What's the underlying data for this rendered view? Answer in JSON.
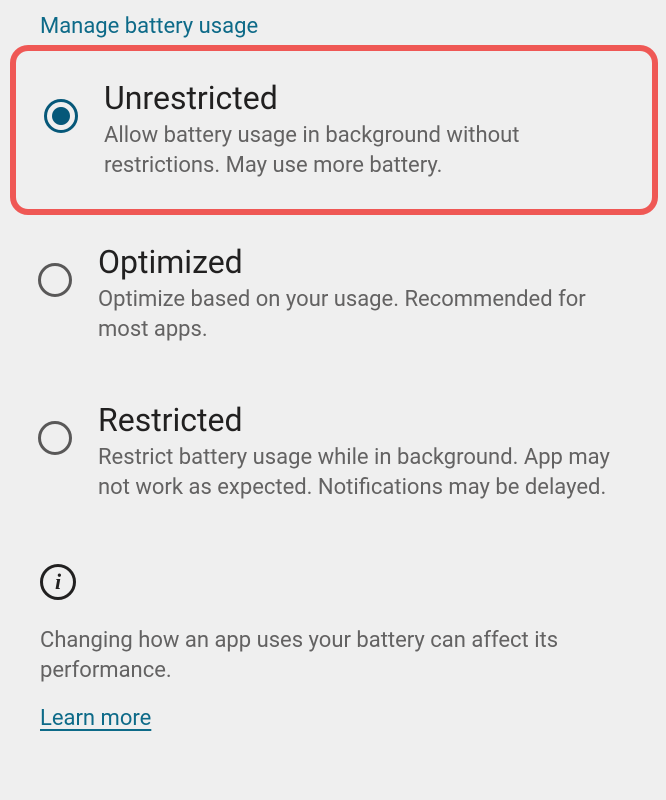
{
  "section": {
    "header": "Manage battery usage"
  },
  "options": [
    {
      "title": "Unrestricted",
      "description": "Allow battery usage in background without restrictions. May use more battery.",
      "selected": true,
      "highlighted": true
    },
    {
      "title": "Optimized",
      "description": "Optimize based on your usage. Recommended for most apps.",
      "selected": false,
      "highlighted": false
    },
    {
      "title": "Restricted",
      "description": "Restrict battery usage while in background. App may not work as expected. Notifications may be delayed.",
      "selected": false,
      "highlighted": false
    }
  ],
  "info": {
    "text": "Changing how an app uses your battery can affect its performance.",
    "learn_more": "Learn more"
  }
}
